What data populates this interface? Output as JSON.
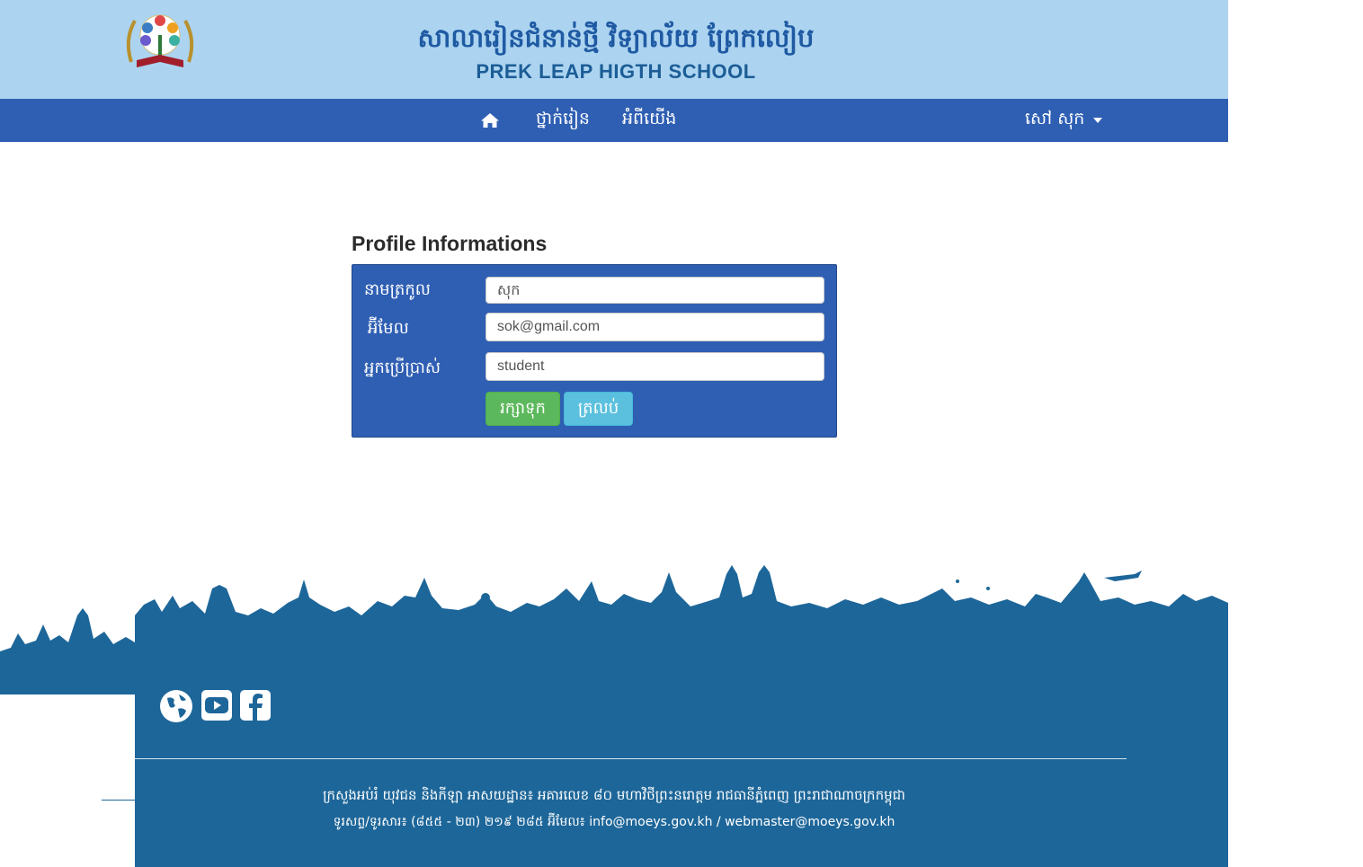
{
  "header": {
    "school_name_kh": "សាលារៀនជំនាន់ថ្មី វិទ្យាល័យ ព្រែកលៀប",
    "school_name_en": "PREK LEAP HIGTH SCHOOL",
    "logo_caption": "វិទ្យាល័យ ព្រែកលៀប PREK LEAP HIGH SCHOOL"
  },
  "nav": {
    "home_icon": "home-icon",
    "classes_label": "ថ្នាក់រៀន",
    "about_label": "អំពីយើង",
    "user_label": "សៅ សុក"
  },
  "profile": {
    "heading": "Profile Informations",
    "fields": {
      "lastname_label": "នាមត្រកូល",
      "lastname_value": "សុក",
      "email_label": "អ៊ីមែល",
      "email_value": "sok@gmail.com",
      "username_label": "អ្នកប្រើប្រាស់",
      "username_value": "student"
    },
    "save_label": "រក្សាទុក",
    "back_label": "ត្រលប់"
  },
  "footer": {
    "social_icons": [
      "globe-icon",
      "youtube-icon",
      "facebook-icon"
    ],
    "address": "ក្រសួងអប់រំ យុវជន និងកីឡា អាសយដ្ឋាន៖ អគារលេខ ៨០ មហាវិថីព្រះនរោត្តម រាជធានីភ្នំពេញ ព្រះរាជាណាចក្រកម្ពុជា",
    "contact": "ទូរសព្ទ/ទូរសារ៖ (៨៥៥ - ២៣) ២១៩ ២៨៥ អ៊ីមែល៖ info@moeys.gov.kh / webmaster@moeys.gov.kh"
  },
  "colors": {
    "header_band": "#acd4f0",
    "navbar": "#2f5fb3",
    "panel": "#2f5fb3",
    "save_button": "#5cb85c",
    "back_button": "#5bc0de",
    "footer": "#1d6699"
  }
}
